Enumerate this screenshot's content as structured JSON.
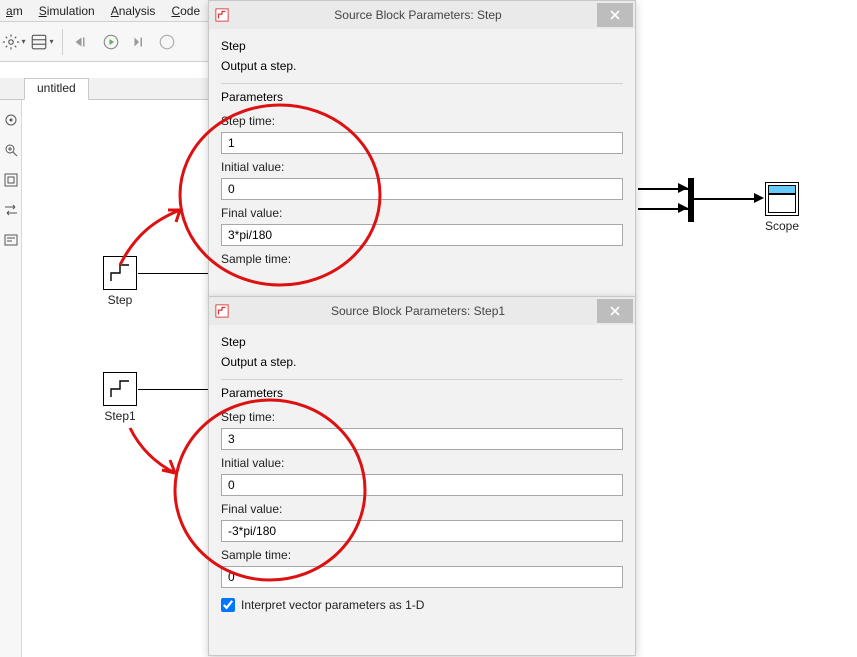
{
  "menu": {
    "m1": "am",
    "m2": "Simulation",
    "m3": "Analysis",
    "m4": "Code"
  },
  "tab": {
    "t1": "untitled"
  },
  "blocks": {
    "step": "Step",
    "step1": "Step1",
    "scope": "Scope"
  },
  "dialog1": {
    "title": "Source Block Parameters: Step",
    "block_heading": "Step",
    "desc": "Output a step.",
    "params_heading": "Parameters",
    "step_time_label": "Step time:",
    "step_time_value": "1",
    "initial_label": "Initial value:",
    "initial_value": "0",
    "final_label": "Final value:",
    "final_value": "3*pi/180",
    "sample_label": "Sample time:"
  },
  "dialog2": {
    "title": "Source Block Parameters: Step1",
    "block_heading": "Step",
    "desc": "Output a step.",
    "params_heading": "Parameters",
    "step_time_label": "Step time:",
    "step_time_value": "3",
    "initial_label": "Initial value:",
    "initial_value": "0",
    "final_label": "Final value:",
    "final_value": "-3*pi/180",
    "sample_label": "Sample time:",
    "sample_value": "0",
    "chk_label": "Interpret vector parameters as 1-D"
  }
}
